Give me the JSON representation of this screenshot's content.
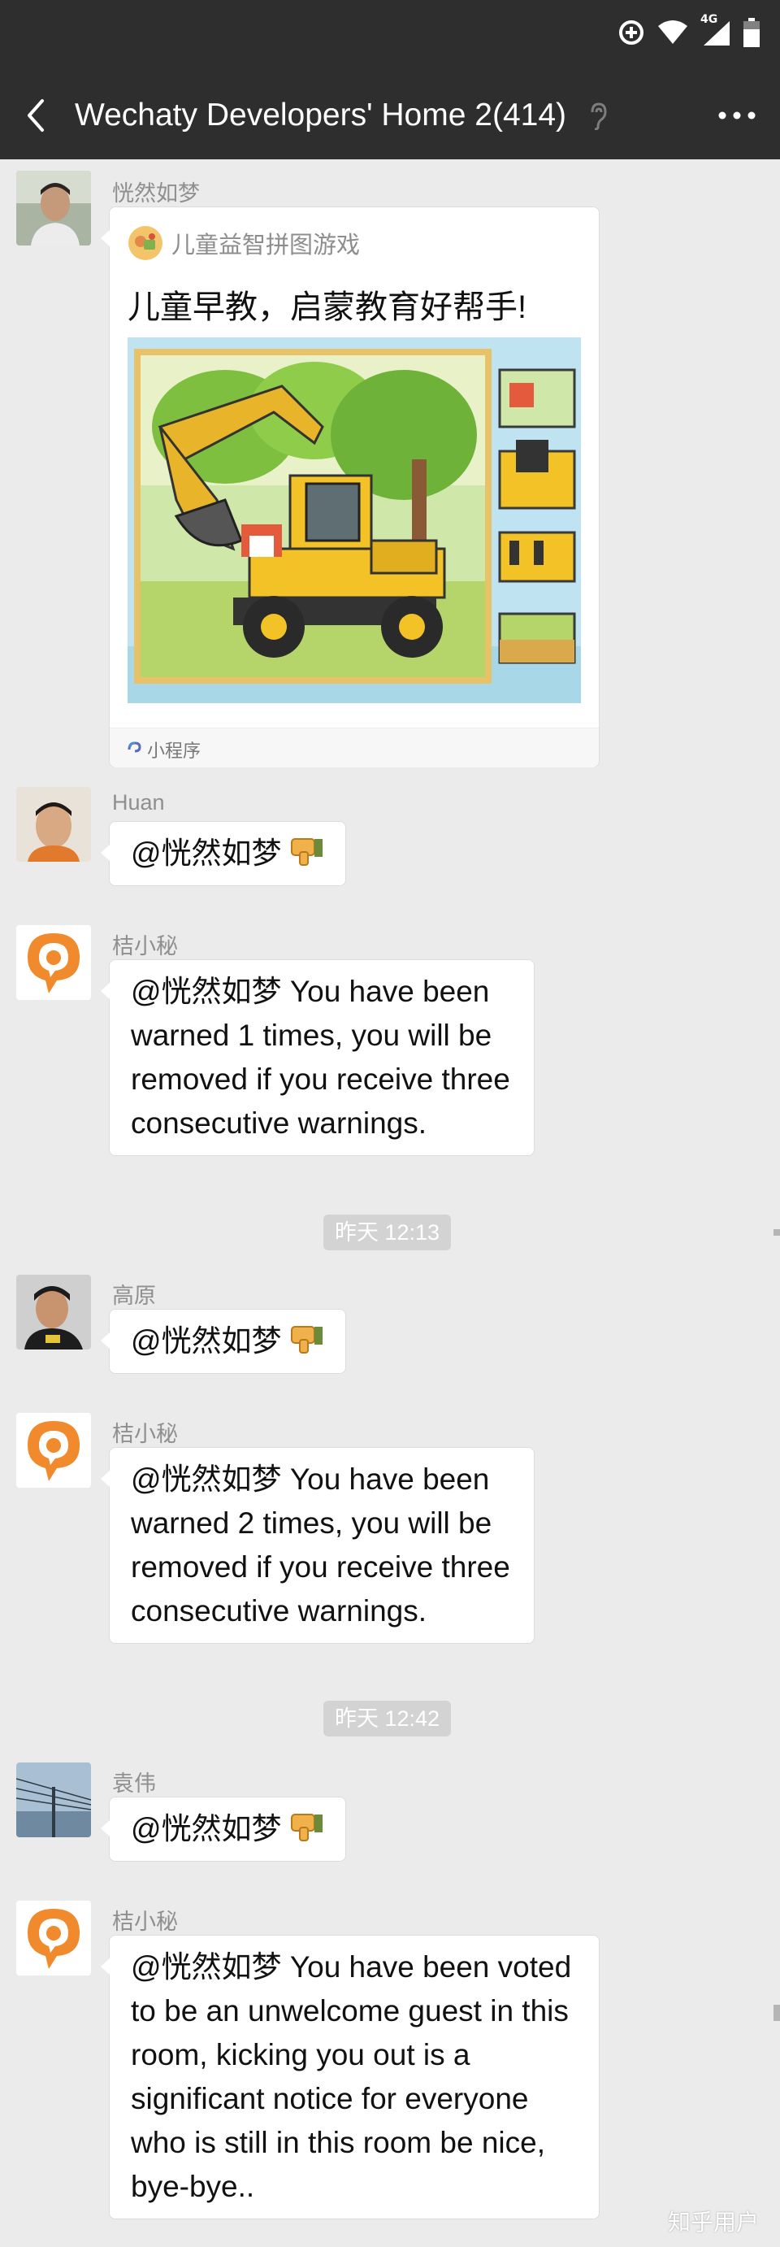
{
  "header": {
    "title": "Wechaty Developers' Home 2(414)",
    "back_icon": "back-arrow-icon",
    "more_icon": "more-dots-icon",
    "mute_icon": "ear-mute-icon"
  },
  "status_bar": {
    "network": "4G"
  },
  "messages": [
    {
      "sender": "恍然如梦",
      "card": {
        "source": "儿童益智拼图游戏",
        "title": "儿童早教，启蒙教育好帮手!",
        "footer": "小程序"
      }
    },
    {
      "sender": "Huan",
      "text": "@恍然如梦"
    },
    {
      "sender": "桔小秘",
      "text": "@恍然如梦 You have been warned  1  times, you will be removed if you receive three consecutive warnings."
    },
    {
      "sender": "高原",
      "text": "@恍然如梦"
    },
    {
      "sender": "桔小秘",
      "text": "@恍然如梦 You have been warned  2  times, you will be removed if you receive three consecutive warnings."
    },
    {
      "sender": "袁伟",
      "text": "@恍然如梦"
    },
    {
      "sender": "桔小秘",
      "text": "@恍然如梦 You have been voted to be an unwelcome guest in this room, kicking you out is a significant notice for everyone who is still in this room be nice, bye-bye.."
    }
  ],
  "timestamps": [
    "昨天 12:13",
    "昨天 12:42"
  ],
  "watermark": "知乎用户",
  "colors": {
    "bar": "#2e2e2e",
    "background": "#ebebeb",
    "bot_orange": "#f08a2c"
  }
}
